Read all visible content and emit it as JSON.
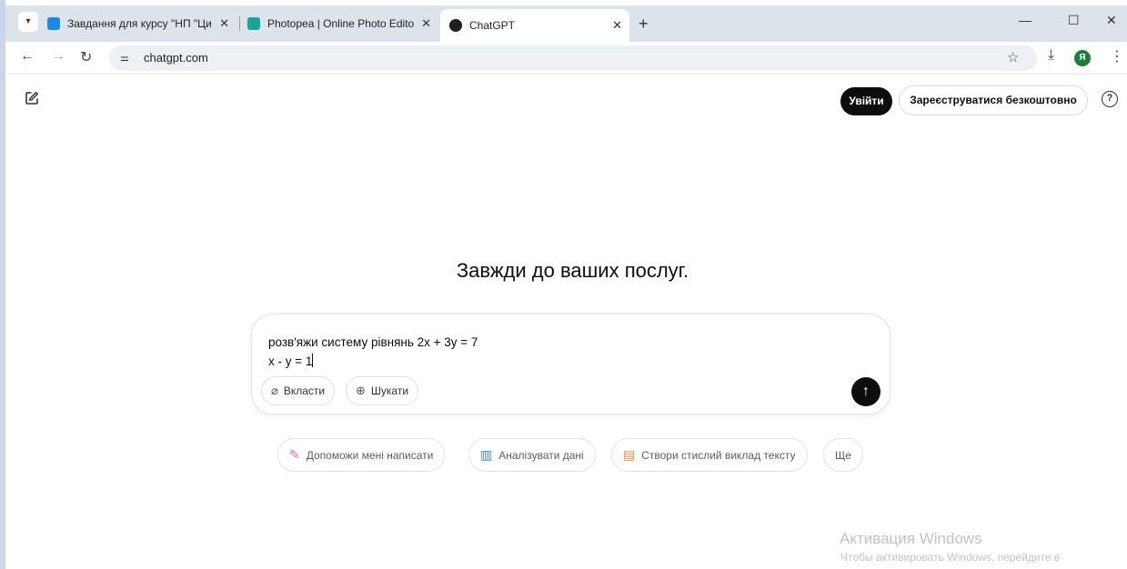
{
  "browser": {
    "tabs": [
      {
        "title": "Завдання для курсу \"НП \"Циф",
        "active": false
      },
      {
        "title": "Photopea | Online Photo Editor",
        "active": false
      },
      {
        "title": "ChatGPT",
        "active": true
      }
    ],
    "url": "chatgpt.com",
    "profile_initial": "Я"
  },
  "header": {
    "login_label": "Увійти",
    "signup_label": "Зареєструватися безкоштовно",
    "help_symbol": "?"
  },
  "main": {
    "headline": "Завжди до ваших послуг.",
    "composer": {
      "line1": "розв'яжи систему рівнянь 2x + 3y = 7",
      "line2": "x - y = 1",
      "attach_label": "Вкласти",
      "search_label": "Шукати"
    },
    "suggestions": [
      {
        "label": "Допоможи мені написати",
        "icon": "pen-icon",
        "color": "#c76ad9"
      },
      {
        "label": "Аналізувати дані",
        "icon": "chart-icon",
        "color": "#3b82f6"
      },
      {
        "label": "Створи стислий виклад тексту",
        "icon": "document-icon",
        "color": "#ea8a3c"
      },
      {
        "label": "Ще",
        "icon": "",
        "color": "#5d5d5d"
      }
    ]
  },
  "watermark": {
    "title": "Активация Windows",
    "subtitle": "Чтобы активировать Windows, перейдите в"
  }
}
